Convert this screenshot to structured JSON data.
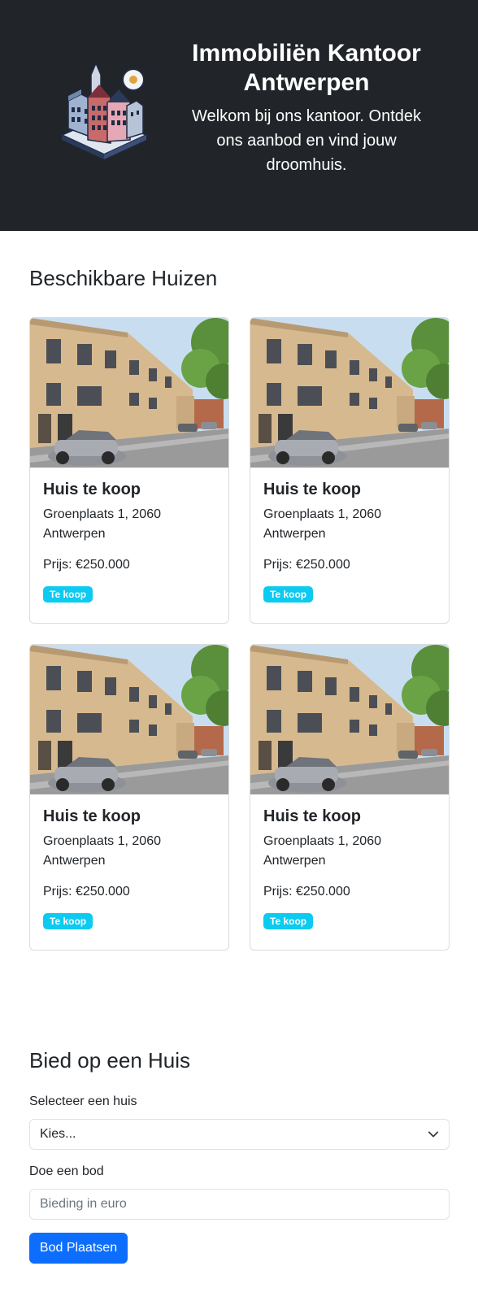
{
  "header": {
    "logo_icon": "isometric-city-buildings-icon",
    "title": "Immobiliën Kantoor Antwerpen",
    "subtitle": "Welkom bij ons kantoor. Ontdek ons aanbod en vind jouw droomhuis."
  },
  "listings": {
    "heading": "Beschikbare Huizen",
    "items": [
      {
        "title": "Huis te koop",
        "address": "Groenplaats 1, 2060 Antwerpen",
        "price": "Prijs: €250.000",
        "badge": "Te koop",
        "image_icon": "street-house-photo"
      },
      {
        "title": "Huis te koop",
        "address": "Groenplaats 1, 2060 Antwerpen",
        "price": "Prijs: €250.000",
        "badge": "Te koop",
        "image_icon": "street-house-photo"
      },
      {
        "title": "Huis te koop",
        "address": "Groenplaats 1, 2060 Antwerpen",
        "price": "Prijs: €250.000",
        "badge": "Te koop",
        "image_icon": "street-house-photo"
      },
      {
        "title": "Huis te koop",
        "address": "Groenplaats 1, 2060 Antwerpen",
        "price": "Prijs: €250.000",
        "badge": "Te koop",
        "image_icon": "street-house-photo"
      }
    ]
  },
  "bid": {
    "heading": "Bied op een Huis",
    "select_label": "Selecteer een huis",
    "select_value": "Kies...",
    "amount_label": "Doe een bod",
    "amount_placeholder": "Bieding in euro",
    "submit_label": "Bod Plaatsen"
  },
  "colors": {
    "header_bg": "#212529",
    "badge_bg": "#0dcaf0",
    "button_bg": "#0d6efd"
  }
}
